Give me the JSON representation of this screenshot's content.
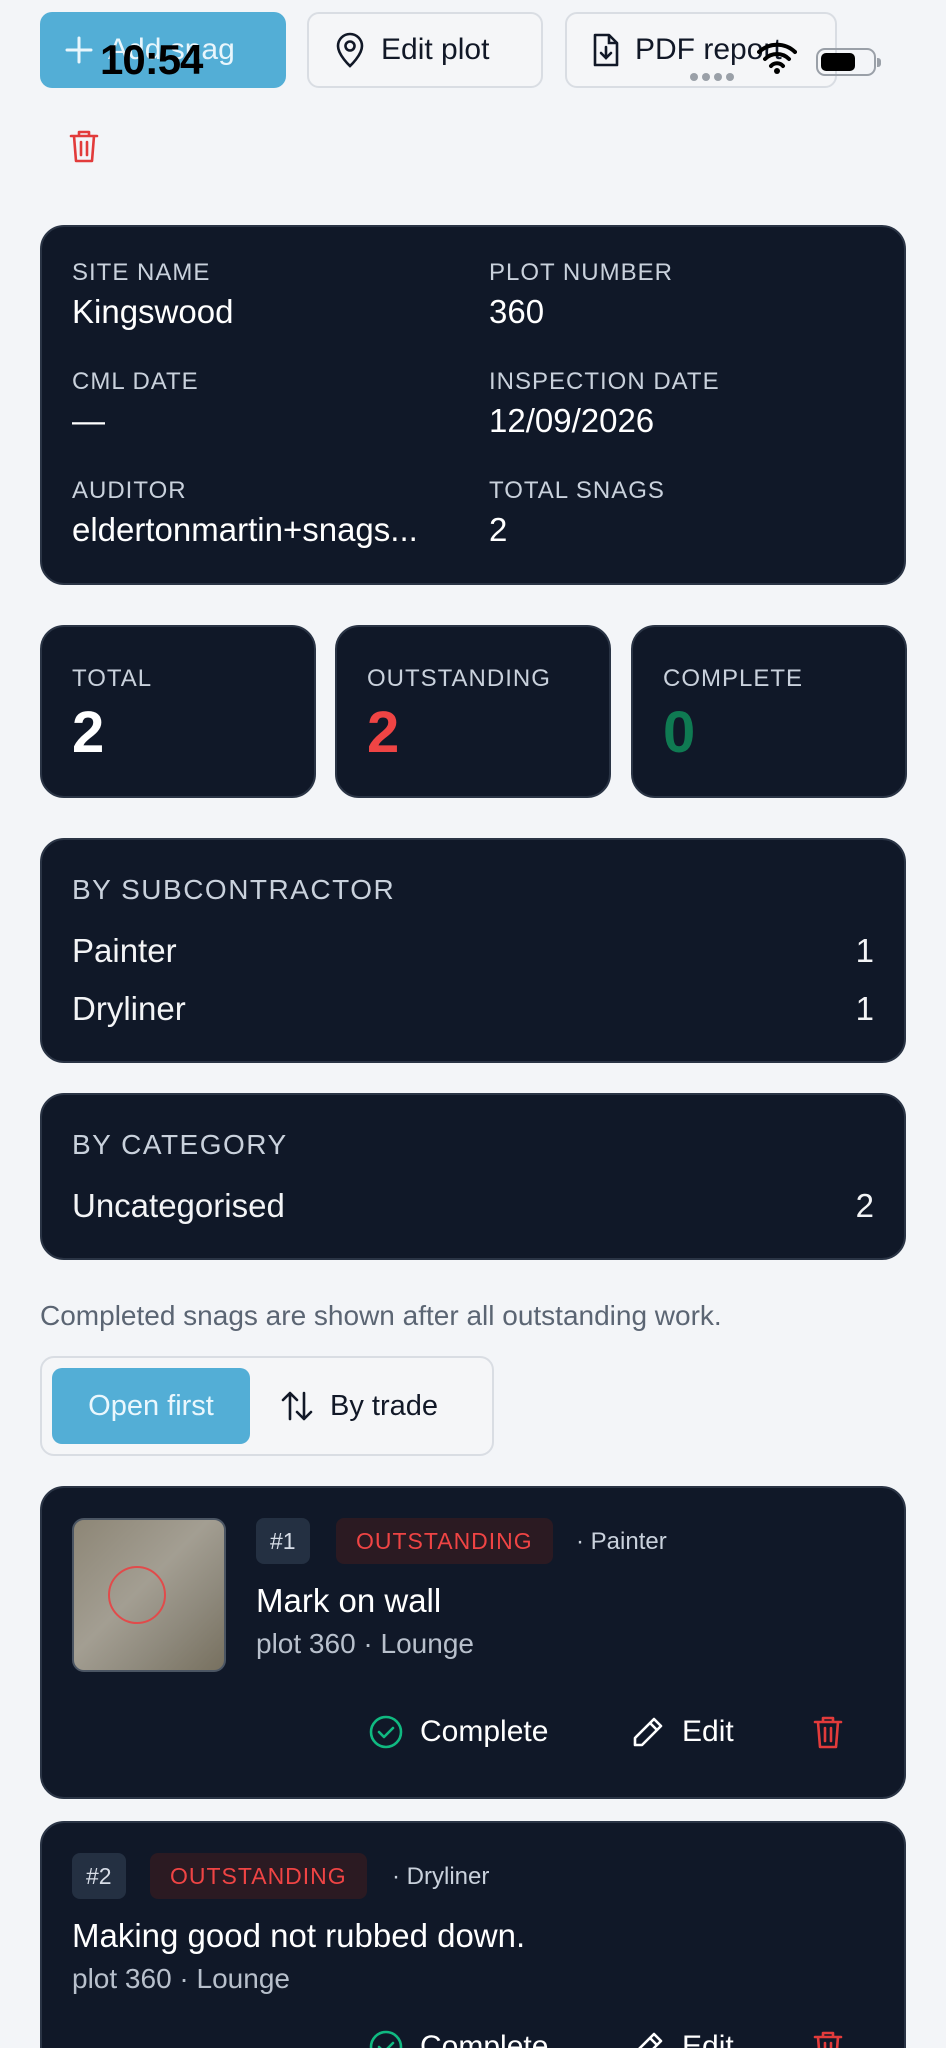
{
  "status_bar": {
    "time": "10:54"
  },
  "toolbar": {
    "add_snag": "Add snag",
    "edit_plot": "Edit plot",
    "pdf_report": "PDF report"
  },
  "info": {
    "site_name_label": "SITE NAME",
    "site_name": "Kingswood",
    "plot_number_label": "PLOT NUMBER",
    "plot_number": "360",
    "cml_date_label": "CML DATE",
    "cml_date": "—",
    "inspection_date_label": "INSPECTION DATE",
    "inspection_date": "12/09/2026",
    "auditor_label": "AUDITOR",
    "auditor": "eldertonmartin+snags...",
    "total_snags_label": "TOTAL SNAGS",
    "total_snags": "2"
  },
  "stats": [
    {
      "label": "TOTAL",
      "value": "2",
      "color": "#ffffff"
    },
    {
      "label": "OUTSTANDING",
      "value": "2",
      "color": "#ef4444"
    },
    {
      "label": "COMPLETE",
      "value": "0",
      "color": "#0f7a52"
    }
  ],
  "by_subcontractor": {
    "title": "BY SUBCONTRACTOR",
    "rows": [
      {
        "name": "Painter",
        "count": "1"
      },
      {
        "name": "Dryliner",
        "count": "1"
      }
    ]
  },
  "by_category": {
    "title": "BY CATEGORY",
    "rows": [
      {
        "name": "Uncategorised",
        "count": "2"
      }
    ]
  },
  "note": "Completed snags are shown after all outstanding work.",
  "sort": {
    "open_first": "Open first",
    "by_trade": "By trade"
  },
  "snags": [
    {
      "number": "#1",
      "status": "OUTSTANDING",
      "trade": "· Painter",
      "title": "Mark on wall",
      "subtitle": "plot 360 · Lounge",
      "complete_label": "Complete",
      "edit_label": "Edit"
    },
    {
      "number": "#2",
      "status": "OUTSTANDING",
      "trade": "· Dryliner",
      "title": "Making good not rubbed down.",
      "subtitle": "plot 360 · Lounge",
      "complete_label": "Complete",
      "edit_label": "Edit"
    }
  ],
  "colors": {
    "accent": "#53aed6",
    "card_bg": "#101828",
    "danger": "#ef4444",
    "success": "#0f7a52"
  }
}
